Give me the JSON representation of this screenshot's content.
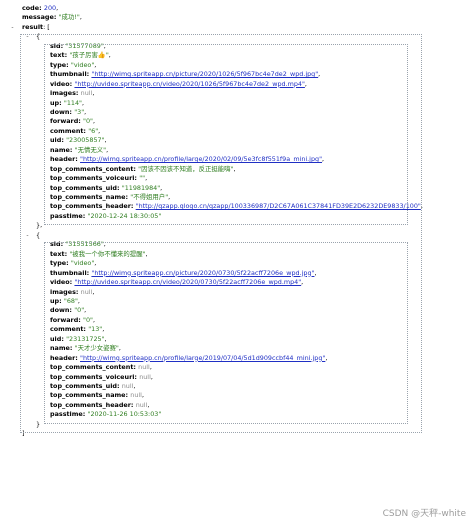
{
  "code": "200",
  "message": "\"成功!\"",
  "result_label": "result",
  "items": [
    {
      "sid": "\"31577089\"",
      "text": "\"孩子厉害👍\"",
      "type": "\"video\"",
      "thumbnail": "\"http://wimg.spriteapp.cn/picture/2020/1026/5f967bc4e7de2_wpd.jpg\"",
      "video": "\"http://uvideo.spriteapp.cn/video/2020/1026/5f967bc4e7de2_wpd.mp4\"",
      "images": "null",
      "up": "\"114\"",
      "down": "\"3\"",
      "forward": "\"0\"",
      "comment": "\"6\"",
      "uid": "\"23005857\"",
      "name": "\"无情无义\"",
      "header": "\"http://wimg.spriteapp.cn/profile/large/2020/02/09/5e3fc8f551f9a_mini.jpg\"",
      "top_comments_content": "\"因该不因该不知道，反正挺能嗨\"",
      "top_comments_voiceuri": "\"\"",
      "top_comments_uid": "\"11981984\"",
      "top_comments_name": "\"不得姐用户\"",
      "top_comments_header": "\"http://qzapp.qlogo.cn/qzapp/100336987/D2C67A061C37841FD39E2D6232DE9833/100\"",
      "passtime": "\"2020-12-24 18:30:05\""
    },
    {
      "sid": "\"31551566\"",
      "text": "\"被我一个你不懂来的提醒\"",
      "type": "\"video\"",
      "thumbnail": "\"http://wimg.spriteapp.cn/picture/2020/0730/5f22acff7206e_wpd.jpg\"",
      "video": "\"http://uvideo.spriteapp.cn/video/2020/0730/5f22acff7206e_wpd.mp4\"",
      "images": "null",
      "up": "\"68\"",
      "down": "\"0\"",
      "forward": "\"0\"",
      "comment": "\"13\"",
      "uid": "\"23131725\"",
      "name": "\"天才少女姿赛\"",
      "header": "\"http://wimg.spriteapp.cn/profile/large/2019/07/04/5d1d909ccbf44_mini.jpg\"",
      "top_comments_content": "null",
      "top_comments_voiceuri": "null",
      "top_comments_uid": "null",
      "top_comments_name": "null",
      "top_comments_header": "null",
      "passtime": "\"2020-11-26 10:53:03\""
    }
  ],
  "watermark": "CSDN @天秤-white"
}
